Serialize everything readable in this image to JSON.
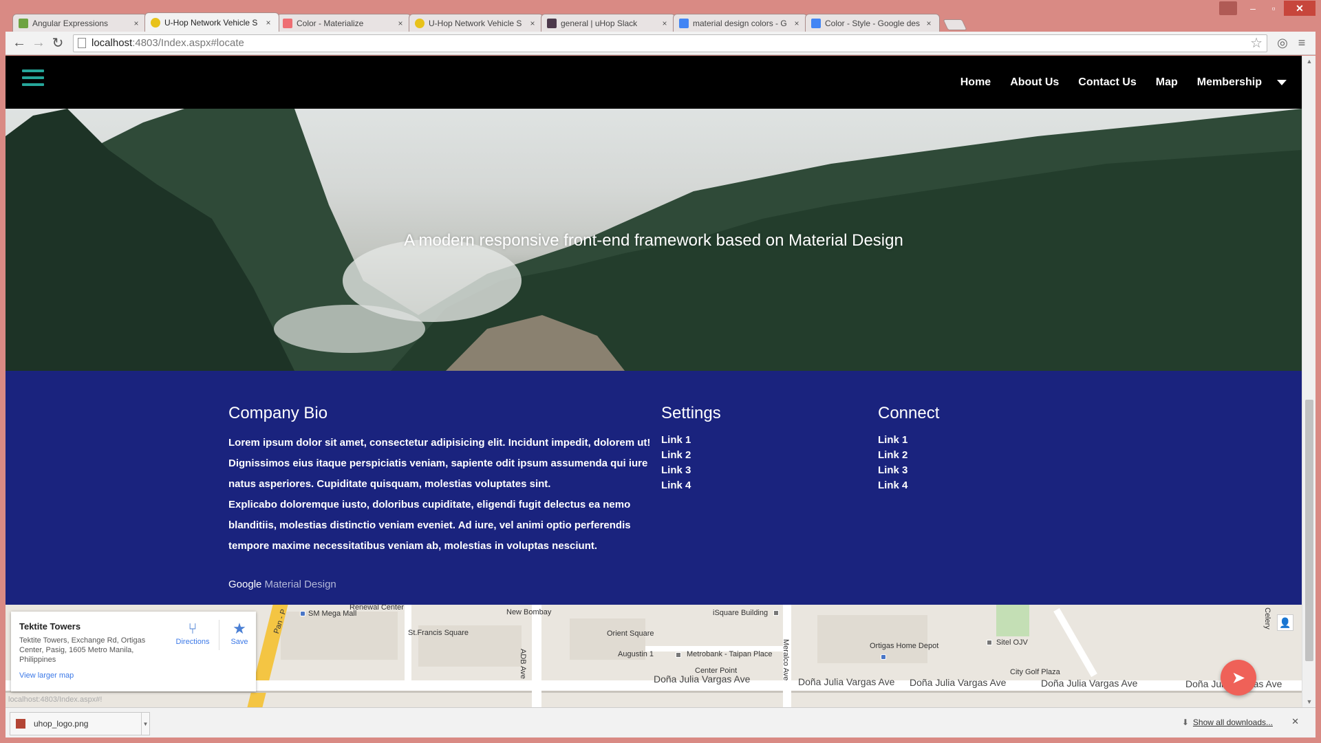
{
  "browser": {
    "tabs": [
      {
        "title": "Angular Expressions",
        "favicon_color": "#6ea341"
      },
      {
        "title": "U-Hop Network Vehicle S",
        "favicon_color": "#e8c21a",
        "active": true
      },
      {
        "title": "Color - Materialize",
        "favicon_color": "#ee6e73"
      },
      {
        "title": "U-Hop Network Vehicle S",
        "favicon_color": "#e8c21a"
      },
      {
        "title": "general | uHop Slack",
        "favicon_color": "#4d394b"
      },
      {
        "title": "material design colors - G",
        "favicon_color": "#4285f4"
      },
      {
        "title": "Color - Style - Google des",
        "favicon_color": "#4285f4"
      }
    ],
    "close_glyph": "×",
    "url_host": "localhost",
    "url_path": ":4803/Index.aspx#locate"
  },
  "navbar": {
    "links": [
      "Home",
      "About Us",
      "Contact Us",
      "Map",
      "Membership"
    ],
    "accent_color": "#26a69a"
  },
  "hero": {
    "tagline": "A modern responsive front-end framework based on Material Design"
  },
  "footer": {
    "bg_color": "#1a237e",
    "bio": {
      "heading": "Company Bio",
      "paragraph1": "Lorem ipsum dolor sit amet, consectetur adipisicing elit. Incidunt impedit, dolorem ut! Dignissimos eius itaque perspiciatis veniam, sapiente odit ipsum assumenda qui iure natus asperiores. Cupiditate quisquam, molestias voluptates sint.",
      "paragraph2": "Explicabo doloremque iusto, doloribus cupiditate, eligendi fugit delectus ea nemo blanditiis, molestias distinctio veniam eveniet. Ad iure, vel animi optio perferendis tempore maxime necessitatibus veniam ab, molestias in voluptas nesciunt."
    },
    "settings": {
      "heading": "Settings",
      "links": [
        "Link 1",
        "Link 2",
        "Link 3",
        "Link 4"
      ]
    },
    "connect": {
      "heading": "Connect",
      "links": [
        "Link 1",
        "Link 2",
        "Link 3",
        "Link 4"
      ]
    },
    "copyright_prefix": "Google",
    "copyright_link": "Material Design"
  },
  "map": {
    "place_name": "Tektite Towers",
    "address": "Tektite Towers, Exchange Rd, Ortigas Center, Pasig, 1605 Metro Manila, Philippines",
    "directions_label": "Directions",
    "save_label": "Save",
    "view_larger": "View larger map",
    "labels": [
      "SM Mega Mall",
      "St.Francis Square",
      "New Bombay",
      "iSquare Building",
      "Orient Square",
      "Augustin 1",
      "Metrobank - Taipan Place",
      "Center Point",
      "Ortigas Home Depot",
      "Sitel OJV",
      "City Golf Plaza",
      "Renewal Center"
    ],
    "street_labels": [
      "Doña Julia Vargas Ave",
      "Doña Julia Vargas Ave",
      "Doña Julia Vargas Ave",
      "Doña Julia Vargas Ave",
      "Doña Julia Vargas Ave"
    ],
    "vertical_labels": [
      "ADB Ave",
      "Meralco Ave",
      "Pan - P",
      "Celery"
    ],
    "status_url": "localhost:4803/Index.aspx#!"
  },
  "downloads": {
    "file_name": "uhop_logo.png",
    "show_all": "Show all downloads..."
  }
}
